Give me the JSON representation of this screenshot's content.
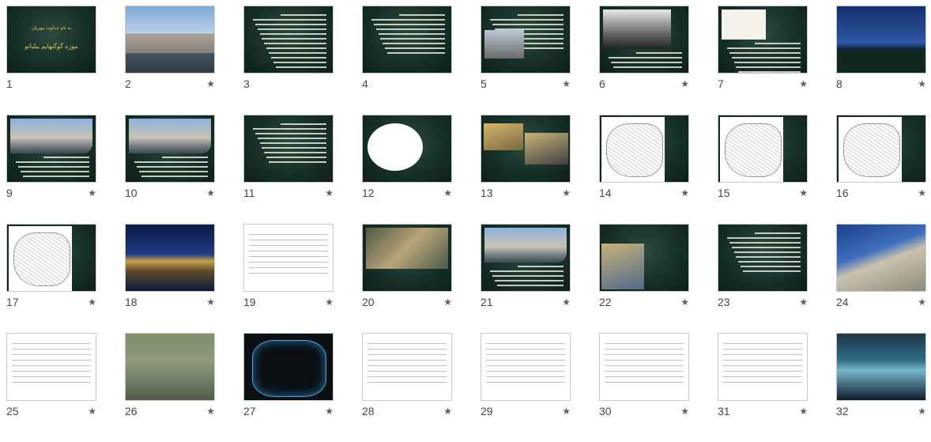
{
  "slides": [
    {
      "num": "1",
      "star": false,
      "kind": "title",
      "caption_lines": [
        "به نام خداوند مهربان",
        "موزه گوگنهایم بیلبائو"
      ]
    },
    {
      "num": "2",
      "star": true,
      "kind": "photo-gugg"
    },
    {
      "num": "3",
      "star": false,
      "kind": "text-list"
    },
    {
      "num": "4",
      "star": false,
      "kind": "text"
    },
    {
      "num": "5",
      "star": true,
      "kind": "photo-text"
    },
    {
      "num": "6",
      "star": true,
      "kind": "portrait"
    },
    {
      "num": "7",
      "star": true,
      "kind": "sketch-text"
    },
    {
      "num": "8",
      "star": true,
      "kind": "photo-night-text"
    },
    {
      "num": "9",
      "star": true,
      "kind": "photo-gugg-text"
    },
    {
      "num": "10",
      "star": true,
      "kind": "photo-gugg-dark"
    },
    {
      "num": "11",
      "star": true,
      "kind": "text"
    },
    {
      "num": "12",
      "star": true,
      "kind": "ellipse-sketch"
    },
    {
      "num": "13",
      "star": true,
      "kind": "photo-pair"
    },
    {
      "num": "14",
      "star": true,
      "kind": "plan-red"
    },
    {
      "num": "15",
      "star": true,
      "kind": "plan-red"
    },
    {
      "num": "16",
      "star": true,
      "kind": "plan-red"
    },
    {
      "num": "17",
      "star": true,
      "kind": "plan-red"
    },
    {
      "num": "18",
      "star": true,
      "kind": "photo-night-text"
    },
    {
      "num": "19",
      "star": true,
      "kind": "white-sketches"
    },
    {
      "num": "20",
      "star": true,
      "kind": "photo-aerial-text"
    },
    {
      "num": "21",
      "star": true,
      "kind": "photo-gugg-text"
    },
    {
      "num": "22",
      "star": true,
      "kind": "photo-text-dark"
    },
    {
      "num": "23",
      "star": true,
      "kind": "text"
    },
    {
      "num": "24",
      "star": true,
      "kind": "photo-blue-text"
    },
    {
      "num": "25",
      "star": true,
      "kind": "white-plan"
    },
    {
      "num": "26",
      "star": true,
      "kind": "photo-city"
    },
    {
      "num": "27",
      "star": true,
      "kind": "wireframe"
    },
    {
      "num": "28",
      "star": true,
      "kind": "white-elevations"
    },
    {
      "num": "29",
      "star": true,
      "kind": "white-elevations-dark"
    },
    {
      "num": "30",
      "star": true,
      "kind": "white-elevations-dark"
    },
    {
      "num": "31",
      "star": true,
      "kind": "white-elevations-red"
    },
    {
      "num": "32",
      "star": true,
      "kind": "photo-cyan"
    }
  ],
  "icons": {
    "star": "star-icon"
  },
  "colors": {
    "accent_red": "#c0131a",
    "slide_dark": "#17302a",
    "caption_gold": "#e1c24f"
  }
}
